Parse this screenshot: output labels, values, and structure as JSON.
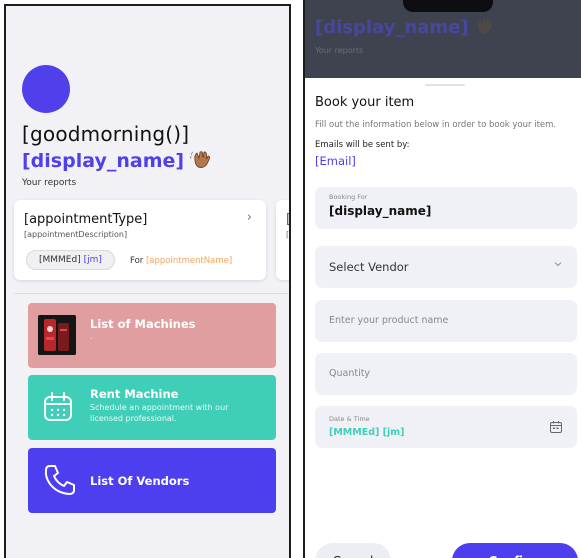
{
  "left": {
    "greeting": "[goodmorning()]",
    "display_name": "[display_name]",
    "reports_label": "Your reports",
    "appointment_card": {
      "type": "[appointmentType]",
      "description": "[appointmentDescription]",
      "date": "[MMMEd]",
      "time": "[jm]",
      "for_label": "For",
      "name": "[appointmentName]"
    },
    "appointment_card_peek": {
      "type": "[c",
      "description": "[a"
    },
    "tiles": {
      "machines": {
        "title": "List of Machines",
        "subtitle": "."
      },
      "rent": {
        "title": "Rent Machine",
        "subtitle": "Schedule an appointment with our licensed professional."
      },
      "vendors": {
        "title": "List Of Vendors"
      }
    }
  },
  "right": {
    "background": {
      "display_name": "[display_name]",
      "reports_label": "Your reports"
    },
    "sheet": {
      "title": "Book your item",
      "description": "Fill out the information below in order to book your item.",
      "emails_label": "Emails will be sent by:",
      "email": "[Email]",
      "booking_for": {
        "label": "Booking For",
        "value": "[display_name]"
      },
      "vendor_select": {
        "value": "Select Vendor"
      },
      "product_input": {
        "placeholder": "Enter your product name"
      },
      "quantity_input": {
        "placeholder": "Quantity"
      },
      "datetime": {
        "label": "Date & Time",
        "date": "[MMMEd]",
        "time": "[jm]"
      },
      "cancel_label": "Cancel",
      "confirm_label": "Confirm"
    }
  },
  "colors": {
    "brand": "#5040ec",
    "machines_tile": "#e09ea0",
    "rent_tile": "#3fcfb9",
    "vendors_tile": "#4d3ef0",
    "accent_orange": "#f6a25b"
  },
  "icons": [
    "waving-hand-icon",
    "chevron-right-icon",
    "calendar-icon",
    "phone-icon",
    "chevron-down-icon",
    "calendar-small-icon"
  ]
}
